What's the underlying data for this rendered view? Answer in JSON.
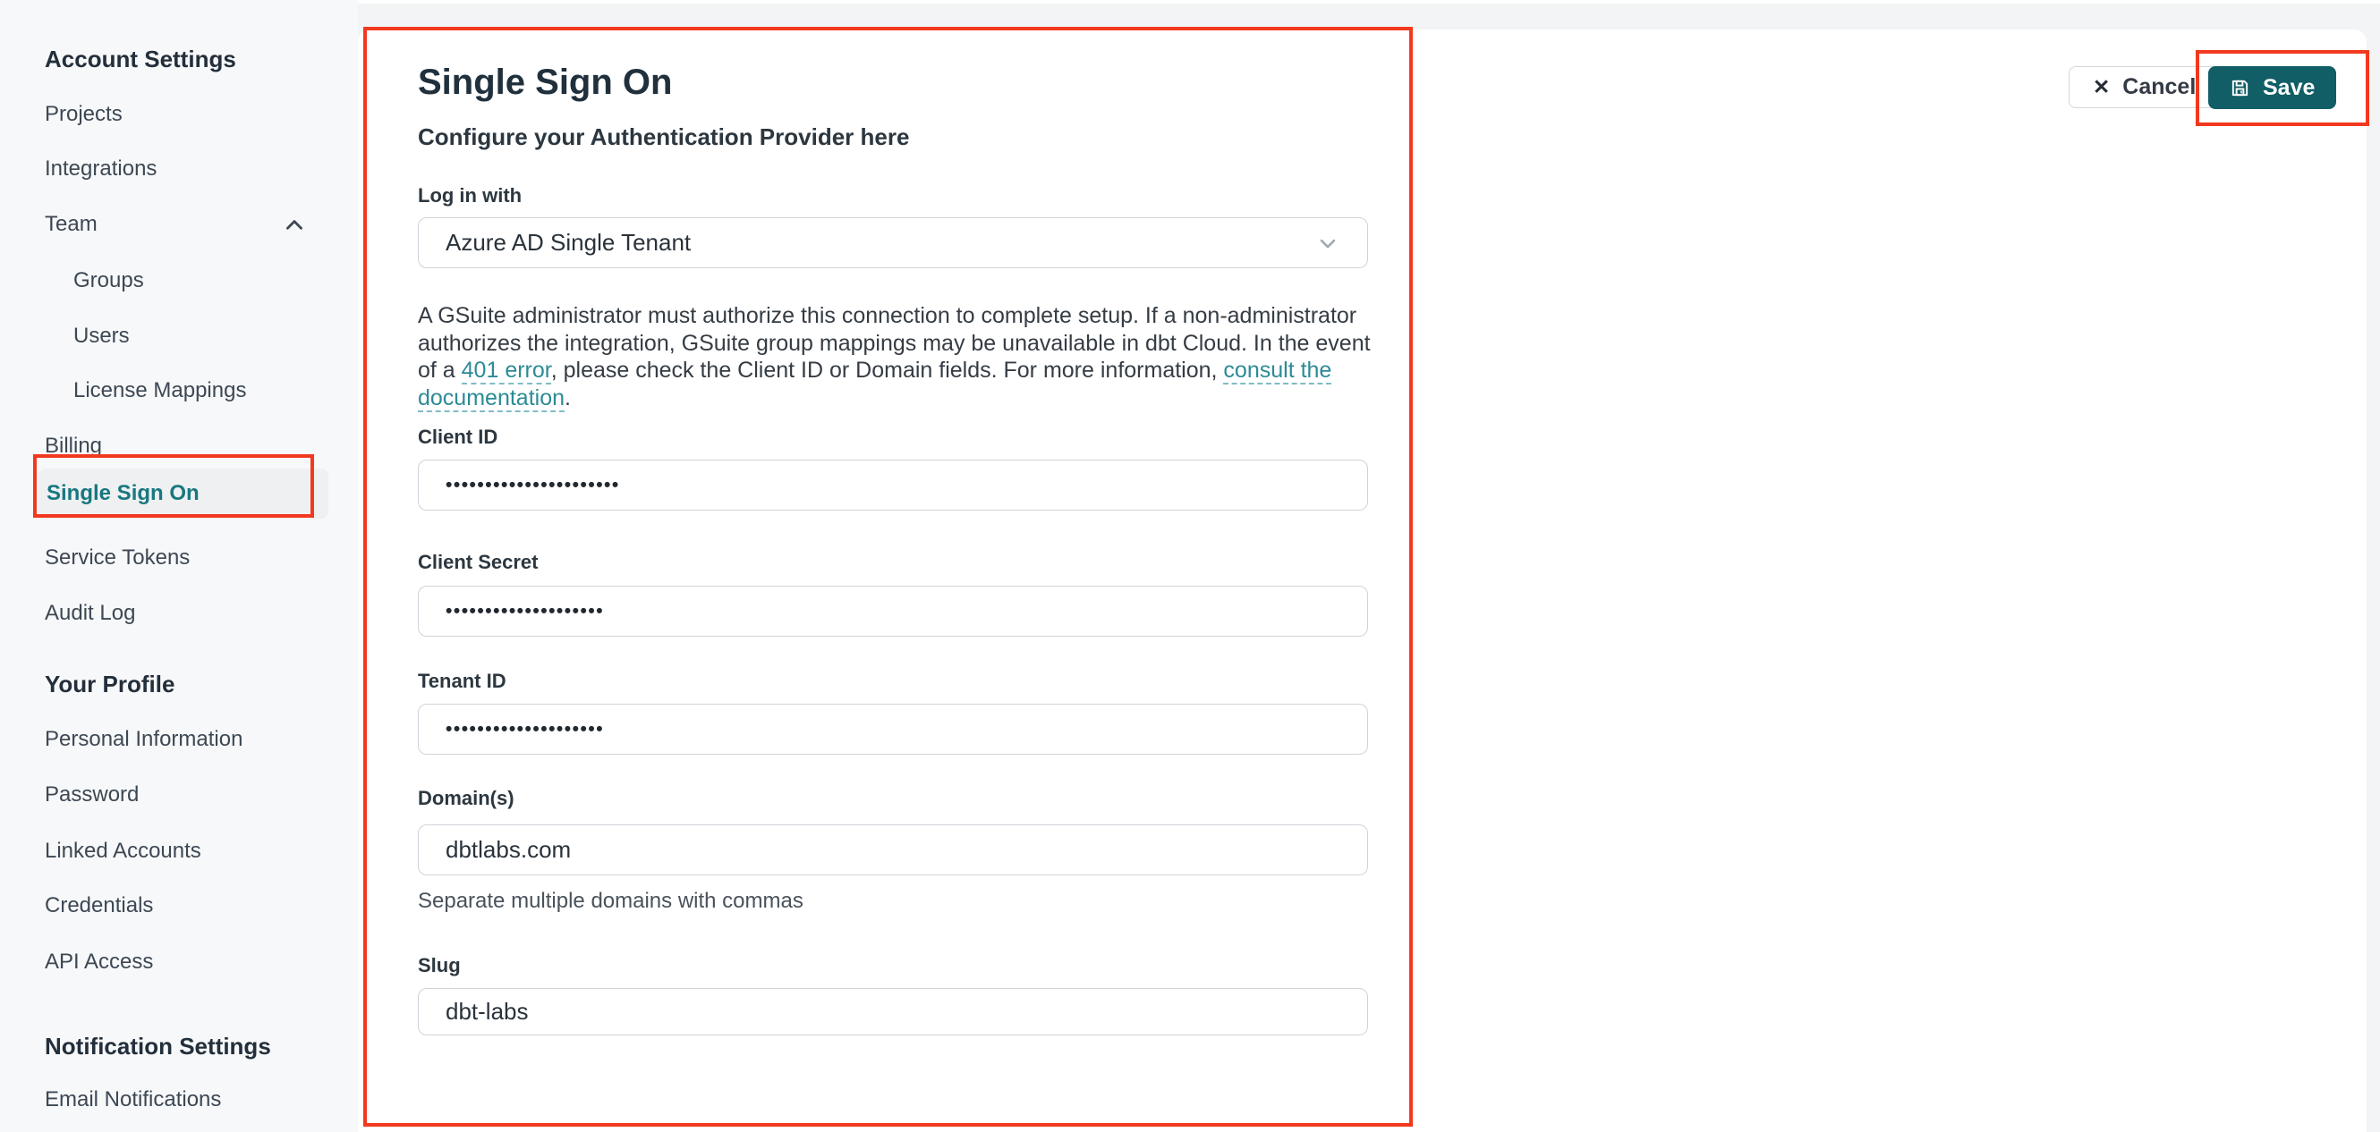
{
  "colors": {
    "accent_teal": "#17787f",
    "save_button_bg": "#115e66",
    "link_teal": "#2b8b96",
    "annotation_red": "#f2391f",
    "sidebar_bg": "#f7f8f9",
    "card_bg": "#ffffff"
  },
  "sidebar": {
    "sections": [
      {
        "heading": "Account Settings",
        "items": [
          {
            "label": "Projects"
          },
          {
            "label": "Integrations"
          },
          {
            "label": "Team"
          },
          {
            "label": "Groups"
          },
          {
            "label": "Users"
          },
          {
            "label": "License Mappings"
          },
          {
            "label": "Billing"
          },
          {
            "label": "Single Sign On",
            "active": true
          },
          {
            "label": "Service Tokens"
          },
          {
            "label": "Audit Log"
          }
        ]
      },
      {
        "heading": "Your Profile",
        "items": [
          {
            "label": "Personal Information"
          },
          {
            "label": "Password"
          },
          {
            "label": "Linked Accounts"
          },
          {
            "label": "Credentials"
          },
          {
            "label": "API Access"
          }
        ]
      },
      {
        "heading": "Notification Settings",
        "items": [
          {
            "label": "Email Notifications"
          }
        ]
      }
    ]
  },
  "header": {
    "cancel_label": "Cancel",
    "cancel_icon": "✕",
    "save_label": "Save"
  },
  "main": {
    "title": "Single Sign On",
    "subtitle": "Configure your Authentication Provider here"
  },
  "form": {
    "login": {
      "label": "Log in with",
      "value": "Azure AD Single Tenant"
    },
    "notice": {
      "text_before": "A GSuite administrator must authorize this connection to complete setup. If a non-administrator authorizes the integration, GSuite group mappings may be unavailable in dbt Cloud. In the event of a ",
      "link_401": "401 error",
      "text_mid": ", please check the Client ID or Domain fields. For more information, ",
      "link_docs": "consult the documentation",
      "text_after": "."
    },
    "client_id": {
      "label": "Client ID",
      "value": "••••••••••••••••••••••"
    },
    "client_secret": {
      "label": "Client Secret",
      "value": "••••••••••••••••••••"
    },
    "tenant_id": {
      "label": "Tenant ID",
      "value": "••••••••••••••••••••"
    },
    "domains": {
      "label": "Domain(s)",
      "value": "dbtlabs.com",
      "helper": "Separate multiple domains with commas"
    },
    "slug": {
      "label": "Slug",
      "value": "dbt-labs"
    }
  }
}
